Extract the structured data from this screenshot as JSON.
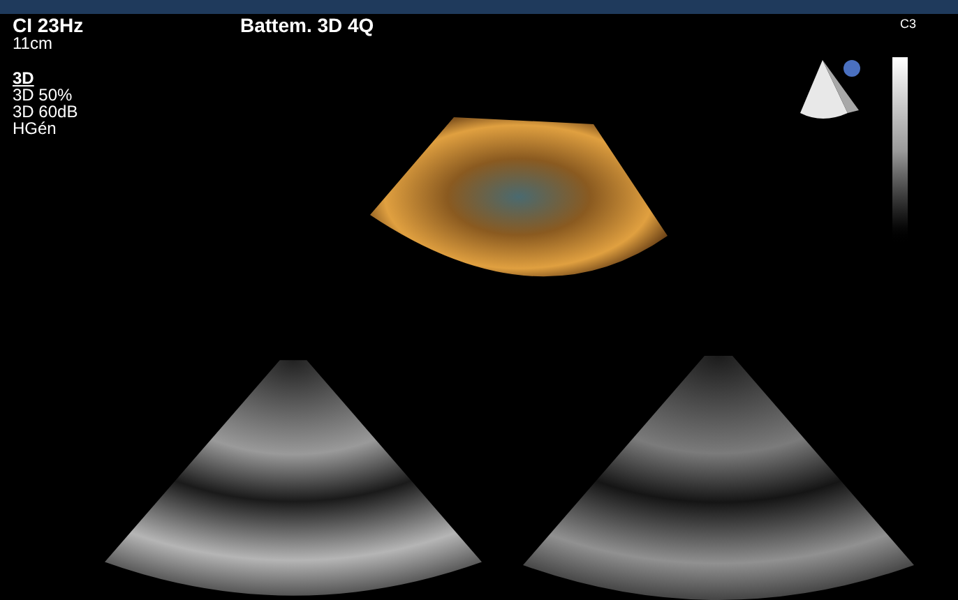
{
  "readout": {
    "frequency": "CI 23Hz",
    "depth": "11cm"
  },
  "mode": {
    "heading": "3D",
    "settings": [
      "3D 50%",
      "3D 60dB",
      "HGén"
    ]
  },
  "title": "Battem. 3D 4Q",
  "scale": {
    "label": "C3"
  }
}
